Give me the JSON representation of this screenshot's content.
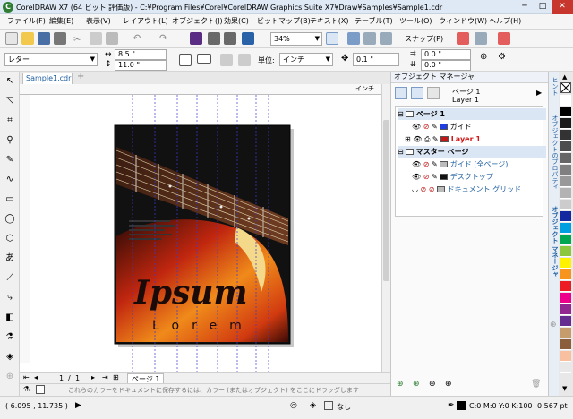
{
  "title_bar": {
    "app_icon": "coreldraw-logo-icon",
    "title": "CorelDRAW X7 (64 ビット 評価版) - C:¥Program Files¥Corel¥CorelDRAW Graphics Suite X7¥Draw¥Samples¥Sample1.cdr",
    "minimize": "─",
    "maximize": "□",
    "close": "✕"
  },
  "menu": {
    "items": [
      "ファイル(F)",
      "編集(E)",
      "表示(V)",
      "レイアウト(L)",
      "オブジェクト(J)",
      "効果(C)",
      "ビットマップ(B)",
      "テキスト(X)",
      "テーブル(T)",
      "ツール(O)",
      "ウィンドウ(W)",
      "ヘルプ(H)"
    ]
  },
  "toolbar": {
    "zoom": "34%",
    "snap_label": "スナップ(P)"
  },
  "property_bar": {
    "paper_size": "レター",
    "width": "8.5 \"",
    "height": "11.0 \"",
    "units_label": "単位:",
    "units_value": "インチ",
    "nudge": "0.1 \"",
    "dup_x": "0.0 \"",
    "dup_y": "0.0 \""
  },
  "document": {
    "tab_name": "Sample1.cdr",
    "artwork_title": "Ipsum",
    "artwork_subtitle": "Lorem",
    "ruler_unit": "インチ"
  },
  "page_nav": {
    "current": "1",
    "total": "1",
    "page_tab": "ページ 1"
  },
  "palette_hint": "これらのカラーをドキュメントに保存するには、カラー (またはオブジェクト) をここにドラッグします",
  "status": {
    "coords": "( 6.095 , 11.735 )",
    "fill_label": "なし",
    "color_readout": "C:0 M:0 Y:0 K:100",
    "outline_width": "0.567 pt"
  },
  "docker": {
    "title": "オブジェクト マネージャ",
    "page_label": "ページ 1",
    "layer_label": "Layer 1",
    "tree": {
      "page1": "ページ 1",
      "guides": "ガイド",
      "layer1": "Layer 1",
      "master": "マスター ページ",
      "guides_all": "ガイド (全ページ)",
      "desktop": "デスクトップ",
      "doc_grid": "ドキュメント グリッド"
    },
    "side_tabs": [
      "ヒント",
      "オブジェクトのプロパティ",
      "オブジェクト マネージャ"
    ]
  },
  "colors": {
    "guides_swatch": "#1f3de0",
    "layer1_swatch": "#c01818",
    "layer1_text": "#d11a1a",
    "accent": "#1f5fa0",
    "palette": [
      "#ffffff",
      "#000000",
      "#1a1a1a",
      "#333333",
      "#4d4d4d",
      "#666666",
      "#808080",
      "#999999",
      "#b3b3b3",
      "#cccccc",
      "#1428a0",
      "#00a0e0",
      "#00a650",
      "#8dc63f",
      "#fff200",
      "#f7941d",
      "#ed1c24",
      "#ec008c",
      "#92278f",
      "#662d91",
      "#c69c6d",
      "#8b5e3c",
      "#f9c0a0",
      "#e8e8e8"
    ]
  }
}
